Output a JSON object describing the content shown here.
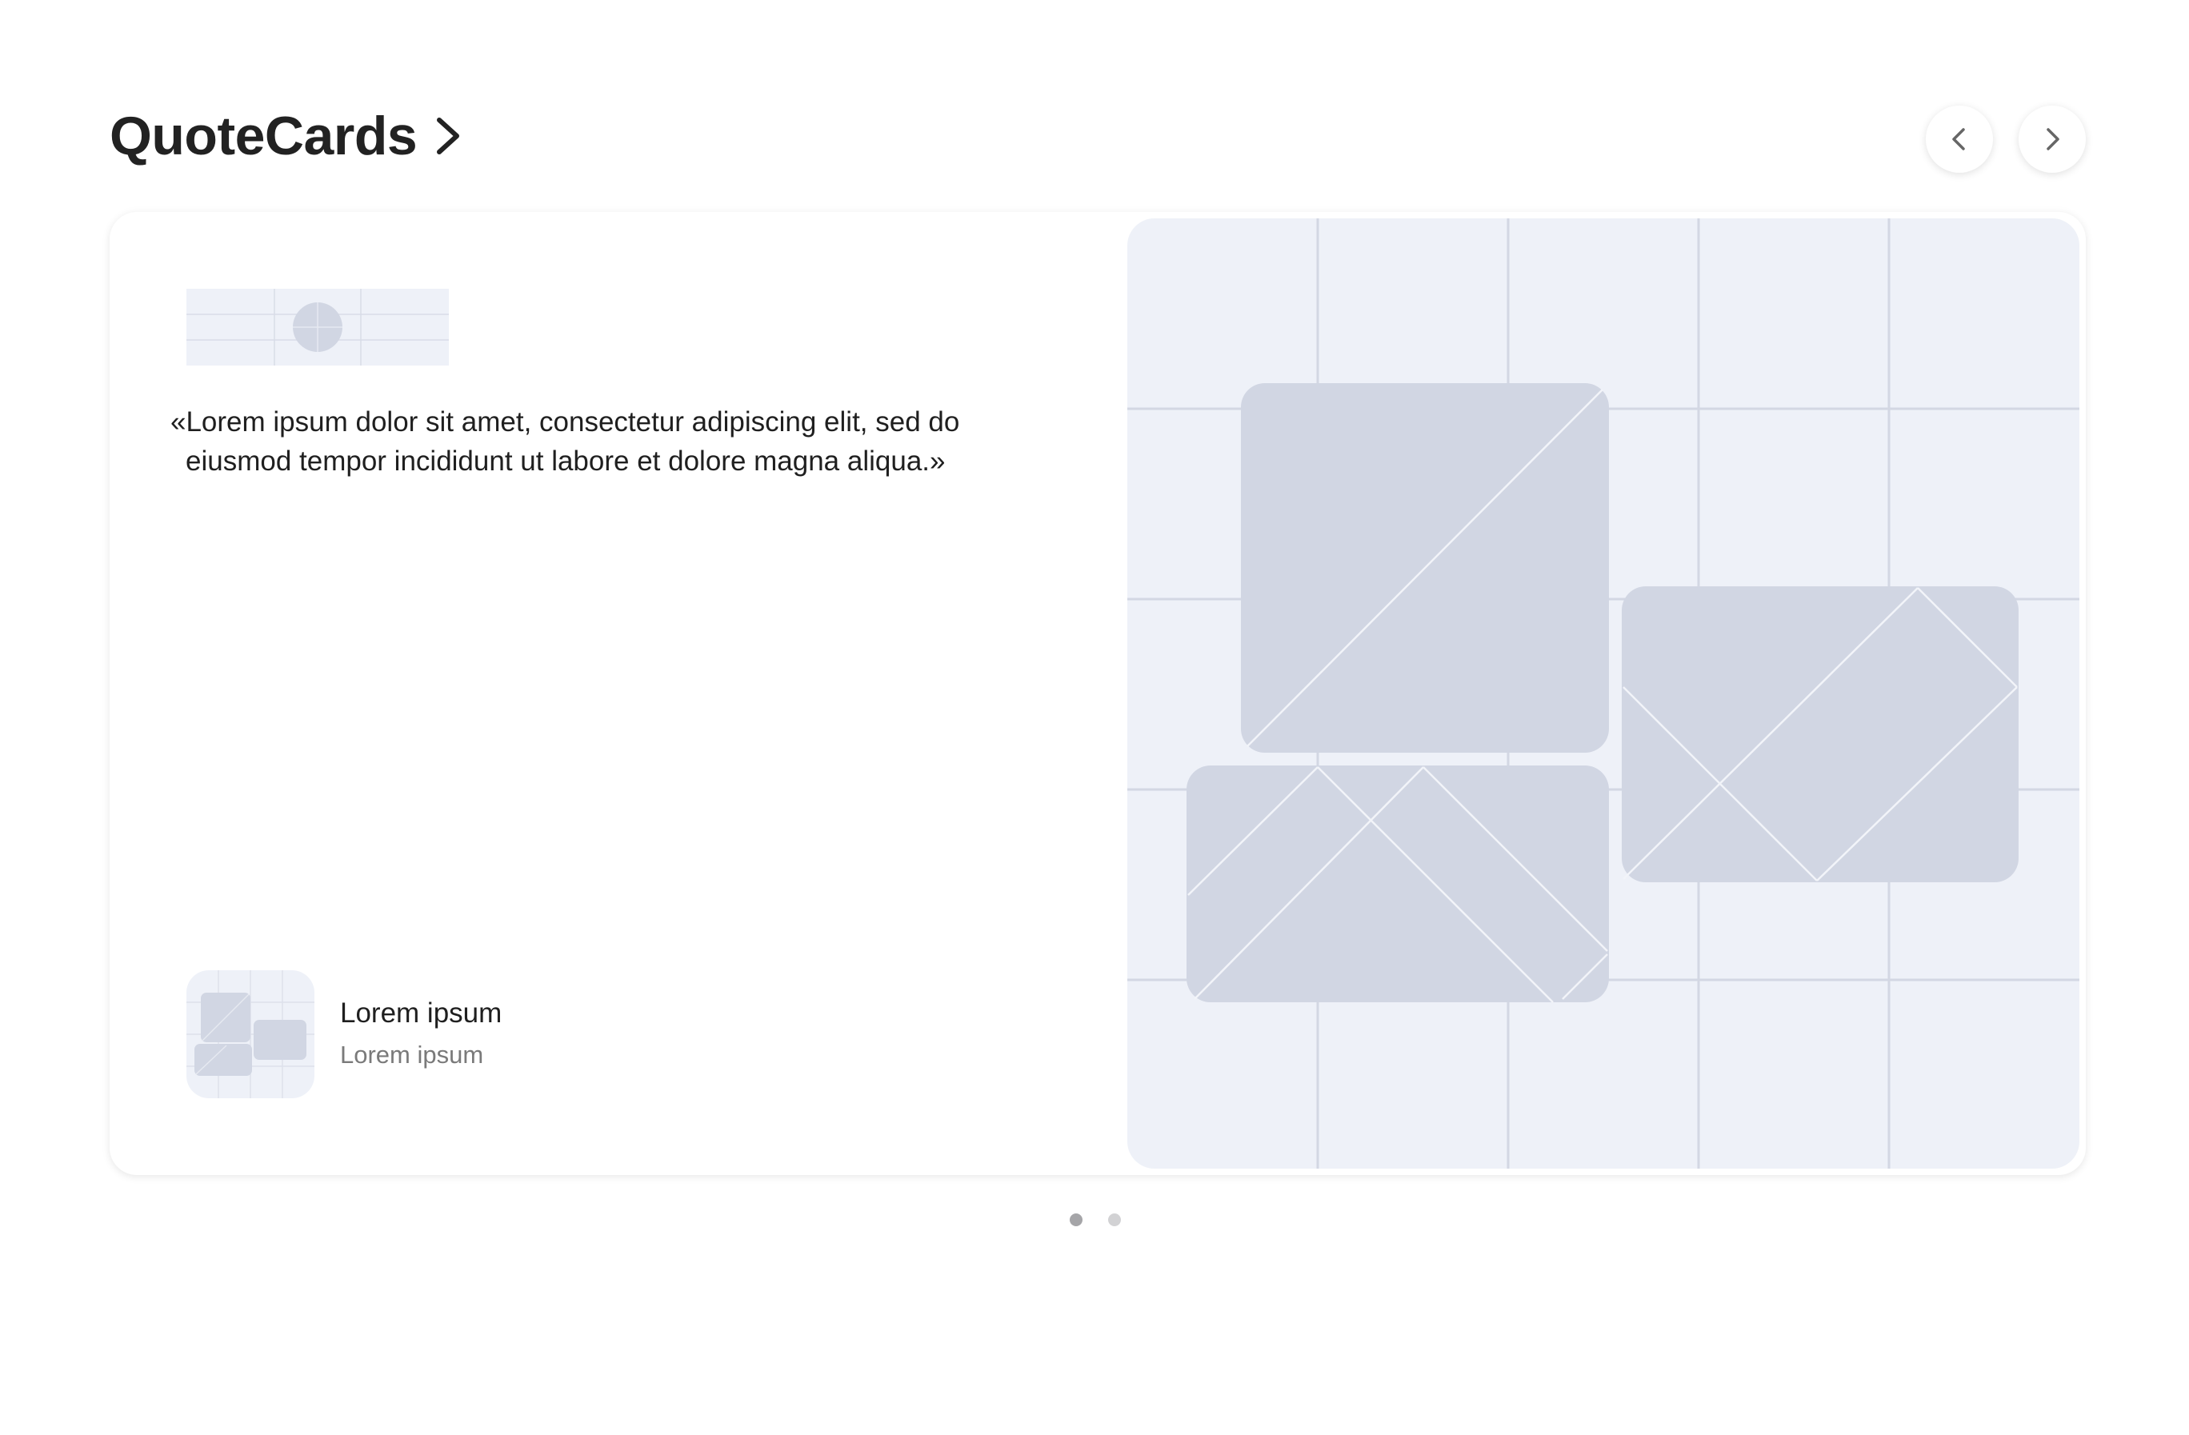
{
  "header": {
    "title": "QuoteCards"
  },
  "slide": {
    "quote_line_1": "«Lorem ipsum dolor sit amet, consectetur adipiscing elit, sed do",
    "quote_line_2": "eiusmod tempor incididunt ut labore et dolore magna aliqua.»",
    "author_name": "Lorem ipsum",
    "author_role": "Lorem ipsum"
  },
  "pagination": {
    "total": 2,
    "active_index": 0
  },
  "colors": {
    "placeholder_bg": "#eef1f8",
    "placeholder_grid": "#d3d7e3",
    "placeholder_shape": "#d1d6e3",
    "dot_active": "#a5a5a8",
    "dot_inactive": "#d2d2d4"
  }
}
